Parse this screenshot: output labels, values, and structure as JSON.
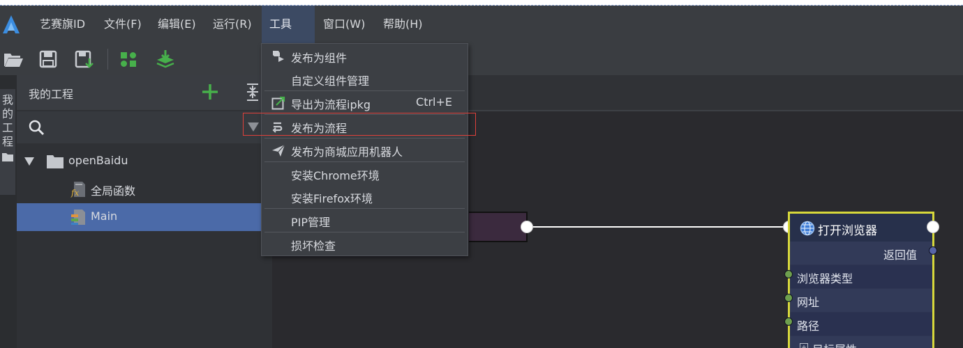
{
  "menubar": {
    "items": [
      "艺赛旗ID",
      "文件(F)",
      "编辑(E)",
      "运行(R)",
      "工具(T)",
      "窗口(W)",
      "帮助(H)"
    ],
    "active": "工具(T)"
  },
  "toolbar": {
    "icons": [
      "open-folder-icon",
      "save-icon",
      "save-as-icon",
      "component-icon",
      "deploy-icon"
    ]
  },
  "left_strip": {
    "tab_chars": [
      "我",
      "的",
      "工",
      "程"
    ]
  },
  "project_panel": {
    "title": "我的工程",
    "search_placeholder": "",
    "tree": [
      {
        "label": "openBaidu",
        "type": "folder",
        "expanded": true
      },
      {
        "label": "全局函数",
        "type": "function"
      },
      {
        "label": "Main",
        "type": "flow",
        "selected": true
      }
    ]
  },
  "tools_menu": {
    "items": [
      {
        "label": "发布为组件",
        "icon": "publish-component-icon"
      },
      {
        "label": "自定义组件管理",
        "icon": ""
      },
      {
        "label": "导出为流程ipkg",
        "icon": "export-icon",
        "shortcut": "Ctrl+E"
      },
      {
        "label": "发布为流程",
        "icon": "publish-flow-icon",
        "highlighted": true
      },
      {
        "label": "发布为商城应用机器人",
        "icon": "send-icon"
      },
      {
        "label": "安装Chrome环境",
        "icon": ""
      },
      {
        "label": "安装Firefox环境",
        "icon": ""
      },
      {
        "label": "PIP管理",
        "icon": ""
      },
      {
        "label": "损坏检查",
        "icon": ""
      }
    ]
  },
  "flow_node": {
    "title": "打开浏览器",
    "output": "返回值",
    "inputs": [
      "浏览器类型",
      "网址",
      "路径",
      "目标属性"
    ]
  },
  "colors": {
    "accent": "#4b6aa8",
    "node_border": "#d7d83b",
    "highlight": "#e0403a",
    "green_icon": "#47b04b"
  }
}
